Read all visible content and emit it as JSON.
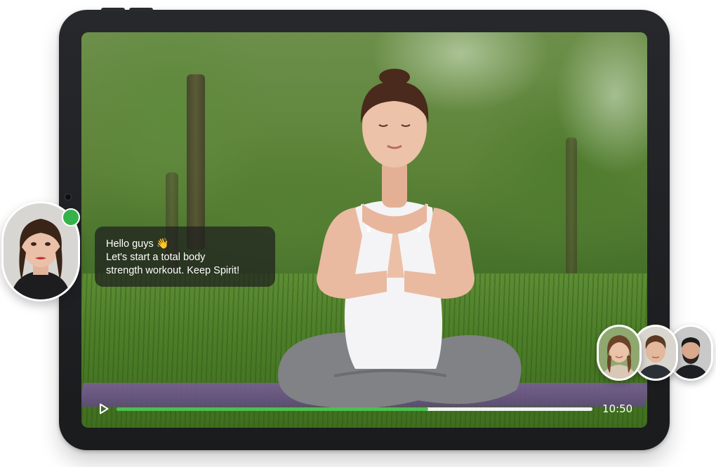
{
  "chat": {
    "greeting": "Hello guys 👋",
    "line2": "Let's start a total body",
    "line3": "strength workout. Keep Spirit!"
  },
  "player": {
    "time": "10:50",
    "progress": 0.655,
    "accent_color": "#4cc04f"
  },
  "host": {
    "status": "online",
    "status_color": "#35b24a"
  },
  "participants": [
    {
      "icon": "participant-avatar-woman"
    },
    {
      "icon": "participant-avatar-man"
    },
    {
      "icon": "participant-avatar-bearded-man"
    }
  ],
  "icons": {
    "play": "play-icon"
  }
}
